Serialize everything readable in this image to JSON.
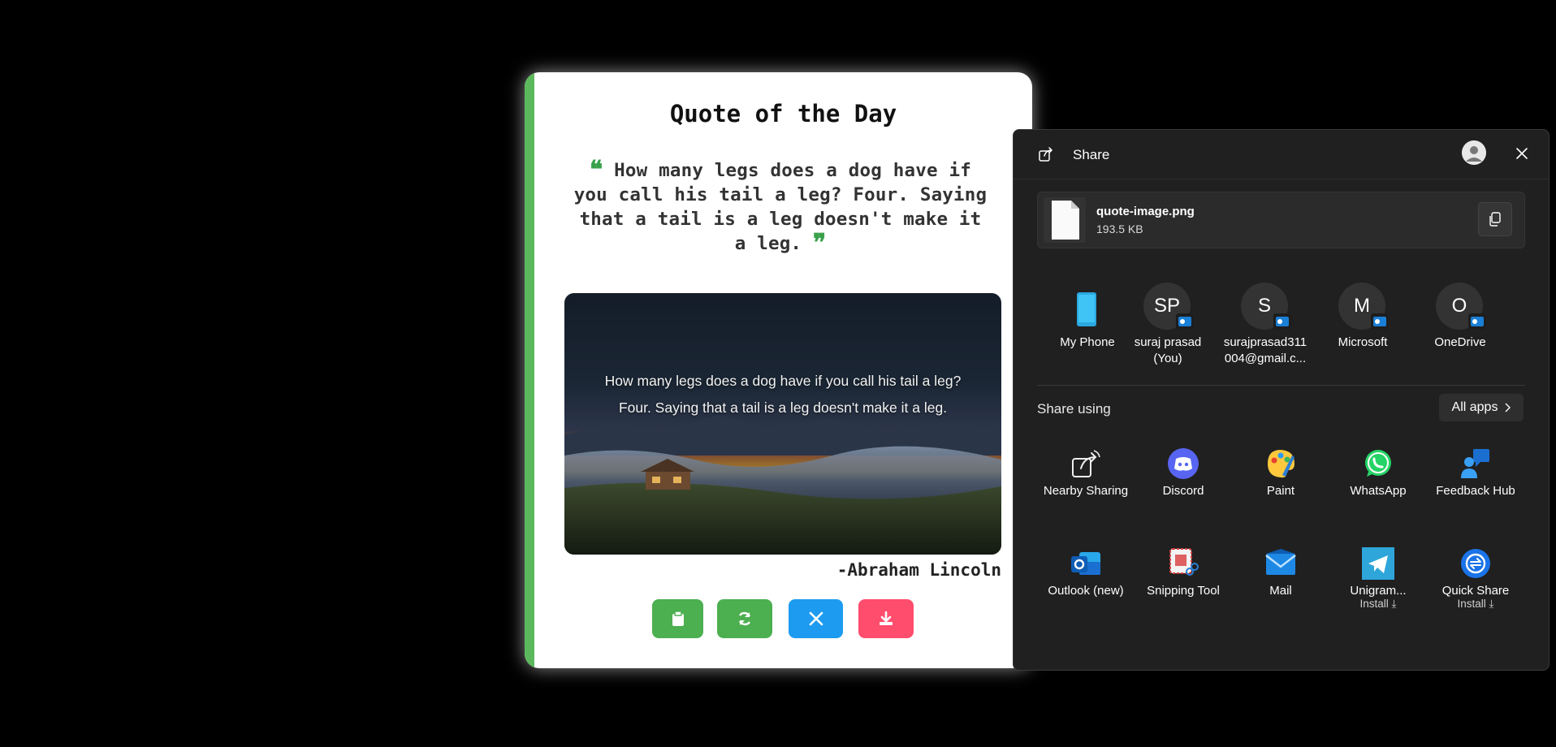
{
  "quote_card": {
    "title": "Quote of the Day",
    "quote": "How many legs does a dog have if you call his tail a leg? Four. Saying that a tail is a leg doesn't make it a leg.",
    "open_quote_mark": "❝",
    "close_quote_mark": "❞",
    "image_quote": "How many legs does a dog have if you call his tail a leg? Four. Saying that a tail is a leg doesn't make it a leg.",
    "author": "-Abraham Lincoln",
    "buttons": [
      {
        "name": "copy-button",
        "icon": "clipboard-icon",
        "color": "#4caf50"
      },
      {
        "name": "refresh-button",
        "icon": "refresh-icon",
        "color": "#4caf50"
      },
      {
        "name": "tweet-button",
        "icon": "x-logo-icon",
        "color": "#1d9bf0"
      },
      {
        "name": "download-button",
        "icon": "download-icon",
        "color": "#ff4d6d"
      }
    ],
    "accent_color": "#5cb85c"
  },
  "share": {
    "title": "Share",
    "file": {
      "name": "quote-image.png",
      "size": "193.5 KB"
    },
    "contacts": [
      {
        "initials": "",
        "label_line1": "My Phone",
        "label_line2": ""
      },
      {
        "initials": "SP",
        "label_line1": "suraj prasad",
        "label_line2": "(You)"
      },
      {
        "initials": "S",
        "label_line1": "surajprasad311",
        "label_line2": "004@gmail.c..."
      },
      {
        "initials": "M",
        "label_line1": "Microsoft",
        "label_line2": ""
      },
      {
        "initials": "O",
        "label_line1": "OneDrive",
        "label_line2": ""
      }
    ],
    "share_using_label": "Share using",
    "all_apps_label": "All apps",
    "apps": [
      {
        "label": "Nearby Sharing",
        "sub": "",
        "icon": "nearby-sharing-icon"
      },
      {
        "label": "Discord",
        "sub": "",
        "icon": "discord-icon"
      },
      {
        "label": "Paint",
        "sub": "",
        "icon": "paint-icon"
      },
      {
        "label": "WhatsApp",
        "sub": "",
        "icon": "whatsapp-icon"
      },
      {
        "label": "Feedback Hub",
        "sub": "",
        "icon": "feedback-hub-icon"
      },
      {
        "label": "Outlook (new)",
        "sub": "",
        "icon": "outlook-icon"
      },
      {
        "label": "Snipping Tool",
        "sub": "",
        "icon": "snipping-tool-icon"
      },
      {
        "label": "Mail",
        "sub": "",
        "icon": "mail-icon"
      },
      {
        "label": "Unigram...",
        "sub": "Install ⤓",
        "icon": "telegram-icon"
      },
      {
        "label": "Quick Share",
        "sub": "Install ⤓",
        "icon": "quick-share-icon"
      }
    ]
  }
}
